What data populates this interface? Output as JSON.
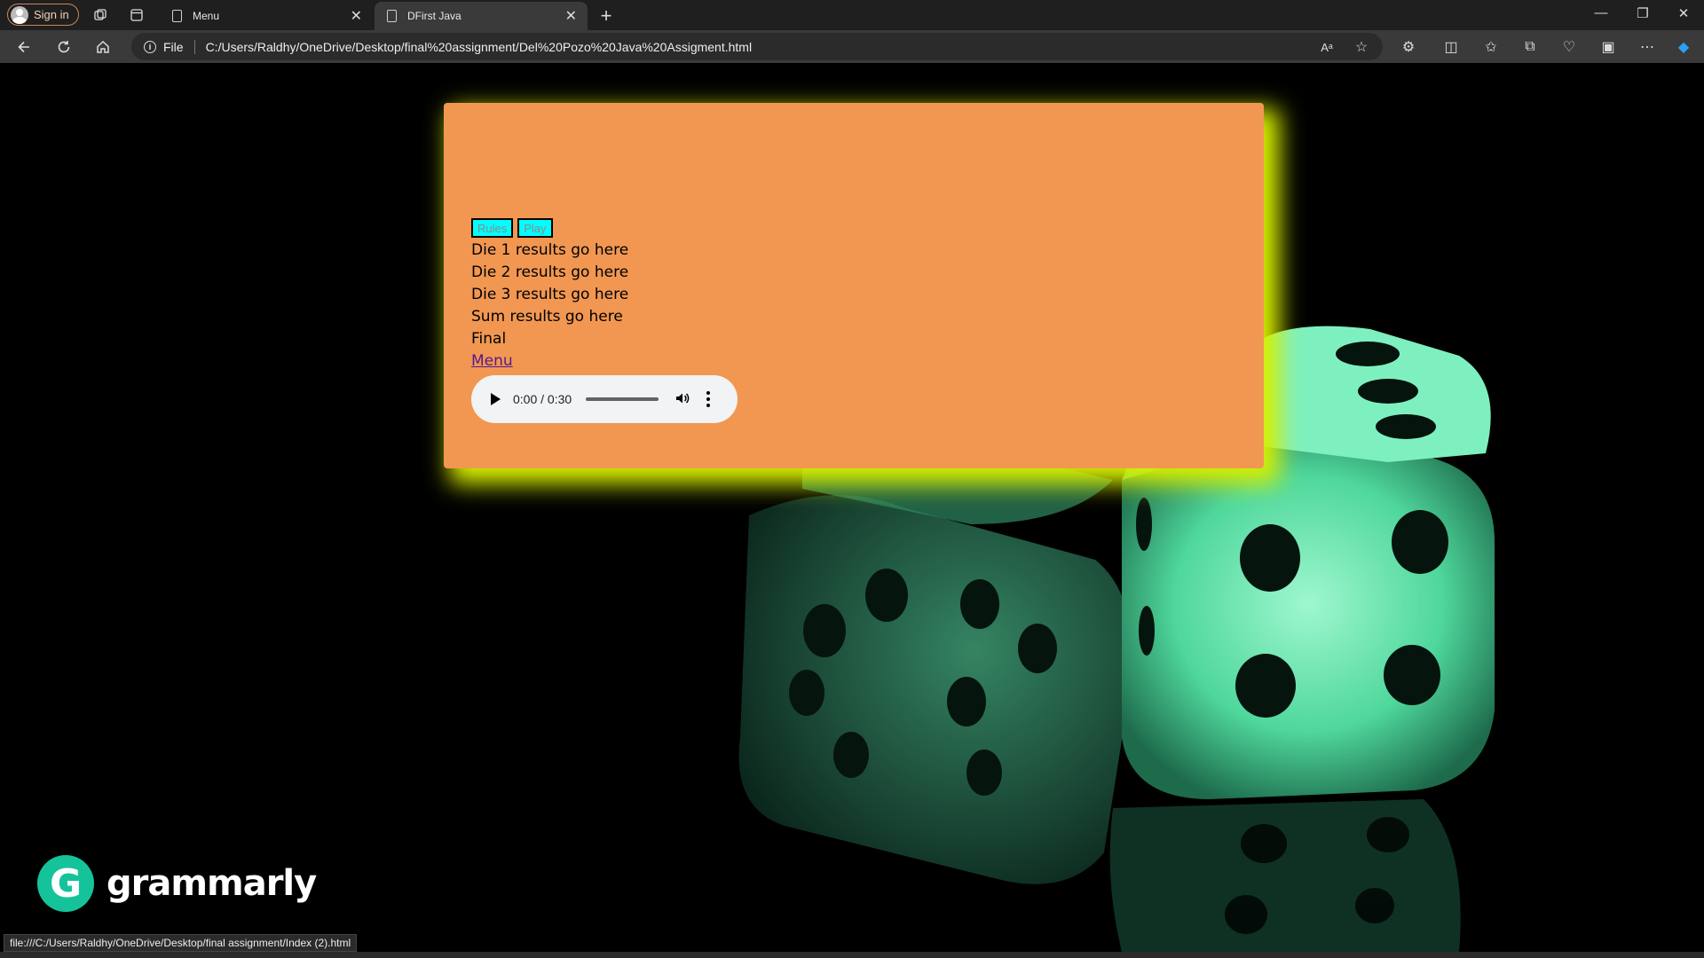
{
  "browser": {
    "profile_label": "Sign in",
    "tabs": [
      {
        "title": "Menu"
      },
      {
        "title": "DFirst Java"
      }
    ],
    "file_label": "File",
    "url": "C:/Users/Raldhy/OneDrive/Desktop/final%20assignment/Del%20Pozo%20Java%20Assigment.html",
    "status_url": "file:///C:/Users/Raldhy/OneDrive/Desktop/final assignment/Index (2).html"
  },
  "page": {
    "buttons": {
      "rules": "Rules",
      "play": "Play"
    },
    "results": {
      "die1": "Die 1 results go here",
      "die2": "Die 2 results go here",
      "die3": "Die 3 results go here",
      "sum": "Sum results go here",
      "final": "Final"
    },
    "menu_link": "Menu",
    "audio": {
      "time": "0:00 / 0:30"
    },
    "watermark": "grammarly",
    "colors": {
      "card": "#f19752",
      "glow": "#d8f000",
      "button": "#00ffff",
      "dice": "#6af0b4"
    }
  }
}
